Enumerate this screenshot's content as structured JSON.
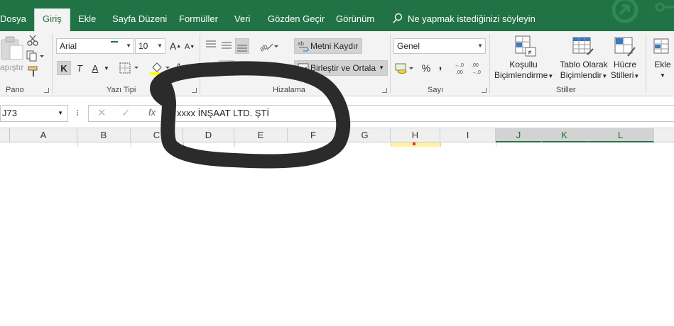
{
  "tabs": [
    {
      "label": "Dosya"
    },
    {
      "label": "Giriş",
      "active": true
    },
    {
      "label": "Ekle"
    },
    {
      "label": "Sayfa Düzeni"
    },
    {
      "label": "Formüller"
    },
    {
      "label": "Veri"
    },
    {
      "label": "Gözden Geçir"
    },
    {
      "label": "Görünüm"
    }
  ],
  "tell_me": "Ne yapmak istediğinizi söyleyin",
  "ribbon": {
    "clipboard": {
      "paste_label": "apıştır",
      "group": "Pano"
    },
    "font": {
      "name": "Arial",
      "size": "10",
      "bold": "K",
      "italic": "T",
      "underline": "A",
      "group": "Yazı Tipi",
      "highlight_color": "#ffff00",
      "font_color": "#ff0000"
    },
    "alignment": {
      "wrap_text": "Metni Kaydır",
      "merge_center": "Birleştir ve Ortala",
      "group": "Hizalama"
    },
    "number": {
      "format": "Genel",
      "percent": "%",
      "comma": ",",
      "group": "Sayı"
    },
    "styles": {
      "conditional_line1": "Koşullu",
      "conditional_line2": "Biçimlendirme",
      "table_line1": "Tablo Olarak",
      "table_line2": "Biçimlendir",
      "cell_line1": "Hücre",
      "cell_line2": "Stilleri",
      "group": "Stiller"
    },
    "cells": {
      "insert": "Ekle"
    }
  },
  "formula_bar": {
    "name_box": "J73",
    "fx": "fx",
    "content": "xxxx İNŞAAT LTD. ŞTİ"
  },
  "columns": [
    "A",
    "B",
    "C",
    "D",
    "E",
    "F",
    "G",
    "H",
    "I",
    "J",
    "K",
    "L"
  ],
  "colors": {
    "accent": "#217346",
    "scribble": "#2b2b2b"
  }
}
